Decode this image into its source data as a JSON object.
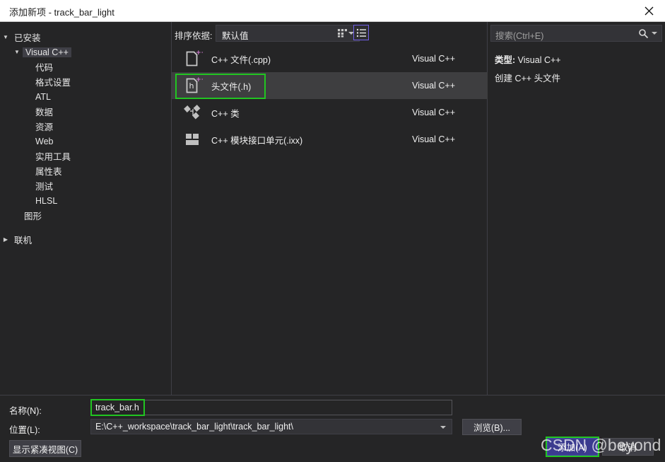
{
  "window": {
    "title": "添加新项 - track_bar_light",
    "close_icon": "close-icon"
  },
  "left_pane": {
    "installed_label": "已安装",
    "tree": [
      {
        "label": "Visual C++",
        "level": 2,
        "expanded": true,
        "selected": true
      },
      {
        "label": "代码",
        "level": 3
      },
      {
        "label": "格式设置",
        "level": 3
      },
      {
        "label": "ATL",
        "level": 3
      },
      {
        "label": "数据",
        "level": 3
      },
      {
        "label": "资源",
        "level": 3
      },
      {
        "label": "Web",
        "level": 3
      },
      {
        "label": "实用工具",
        "level": 3
      },
      {
        "label": "属性表",
        "level": 3
      },
      {
        "label": "测试",
        "level": 3
      },
      {
        "label": "HLSL",
        "level": 3
      },
      {
        "label": "图形",
        "level": 2
      }
    ],
    "online_label": "联机"
  },
  "center_pane": {
    "sort_label": "排序依据:",
    "sort_value": "默认值",
    "view_grid_icon": "grid-view-icon",
    "view_list_icon": "list-view-icon",
    "active_view": "list",
    "items": [
      {
        "name": "C++ 文件(.cpp)",
        "category": "Visual C++",
        "icon": "cpp-file-icon",
        "selected": false
      },
      {
        "name": "头文件(.h)",
        "category": "Visual C++",
        "icon": "header-file-icon",
        "selected": true
      },
      {
        "name": "C++ 类",
        "category": "Visual C++",
        "icon": "cpp-class-icon",
        "selected": false
      },
      {
        "name": "C++ 模块接口单元(.ixx)",
        "category": "Visual C++",
        "icon": "cpp-module-icon",
        "selected": false
      }
    ]
  },
  "right_pane": {
    "search_placeholder": "搜索(Ctrl+E)",
    "search_value": "",
    "search_icon": "search-icon",
    "detail_type_label": "类型:",
    "detail_type_value": "Visual C++",
    "detail_description": "创建 C++ 头文件"
  },
  "footer": {
    "name_label": "名称(N):",
    "name_value": "track_bar.h",
    "location_label": "位置(L):",
    "location_value": "E:\\C++_workspace\\track_bar_light\\track_bar_light\\",
    "browse_button": "浏览(B)...",
    "compact_button": "显示紧凑视图(C)",
    "add_button": "添加(A)",
    "cancel_button": "取消"
  },
  "overlay": {
    "watermark": "CSDN @beyond",
    "annotation_color": "#21c521",
    "accent_color": "#7160e8",
    "primary_button_color": "#3b3b8f"
  }
}
